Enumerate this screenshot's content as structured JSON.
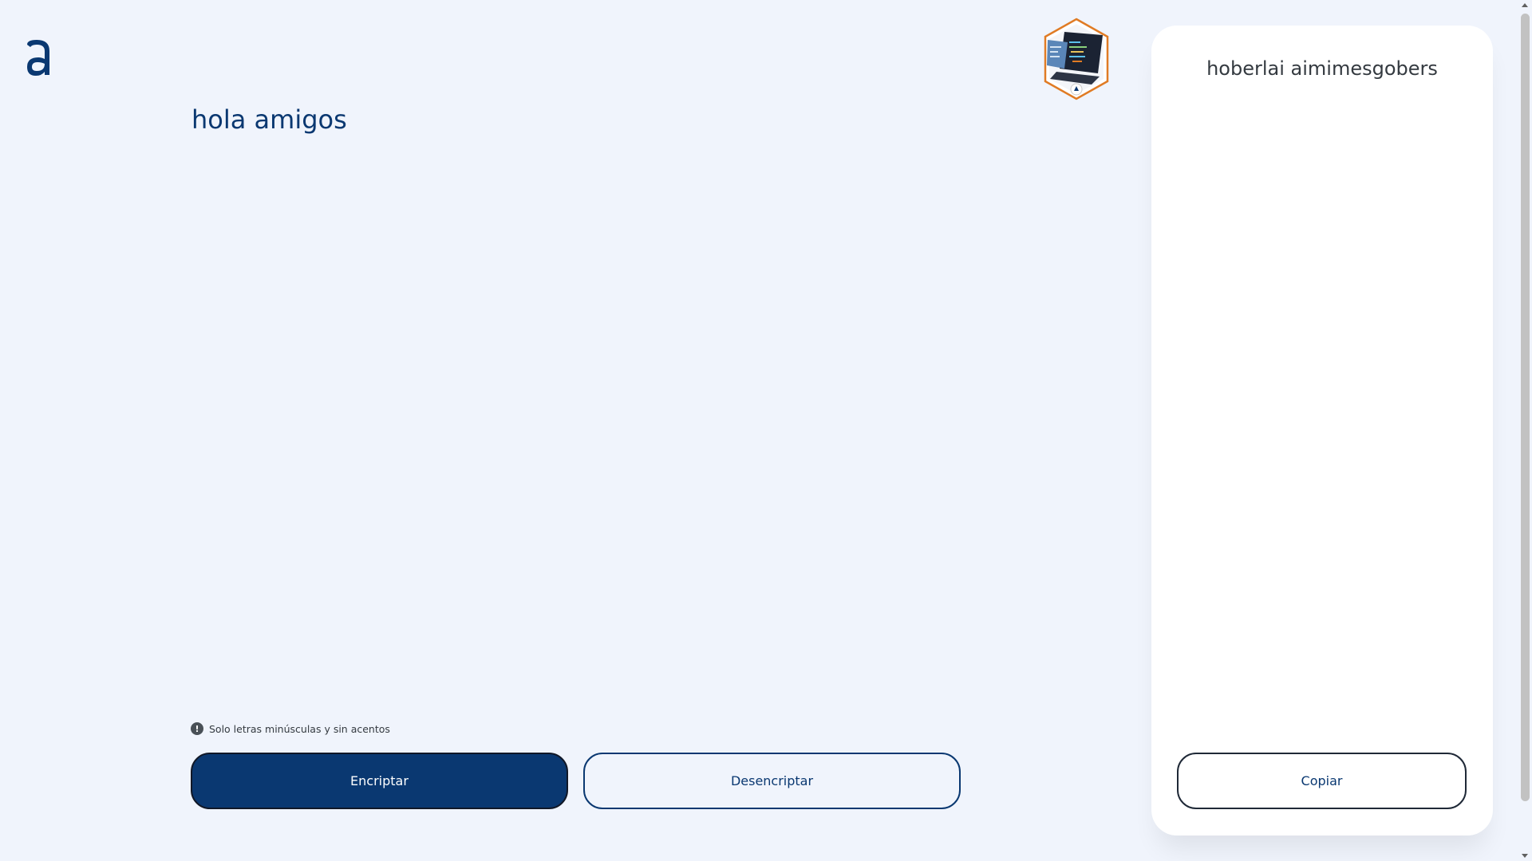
{
  "logo": {
    "icon": "logo-a-icon",
    "color": "#0A3871"
  },
  "input": {
    "value": "hola amigos"
  },
  "badge": {
    "icon": "laptop-hexagon-badge-icon",
    "accent": "#E07B24"
  },
  "hint": {
    "icon": "info-icon",
    "text": "Solo letras minúsculas y sin acentos"
  },
  "buttons": {
    "encrypt_label": "Encriptar",
    "decrypt_label": "Desencriptar",
    "copy_label": "Copiar"
  },
  "output": {
    "text": "hoberlai aimimesgobers"
  },
  "colors": {
    "background": "#F0F4FC",
    "primary": "#0A3871",
    "panel": "#FFFFFF",
    "text_dark": "#343A40"
  }
}
